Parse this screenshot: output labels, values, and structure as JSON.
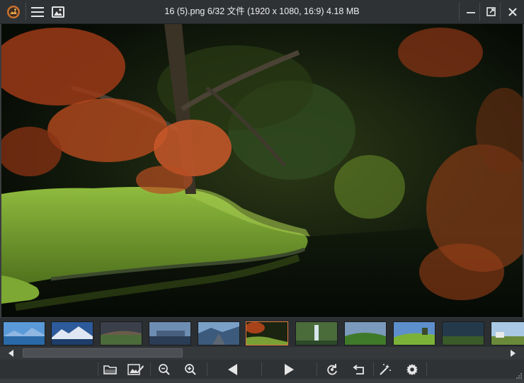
{
  "window": {
    "title": "16 (5).png 6/32 文件 (1920 x 1080, 16:9) 4.18 MB",
    "app_icon": "app-logo-icon",
    "menu_icon": "hamburger-menu-icon",
    "gallery_icon": "image-gallery-icon",
    "controls": [
      "minimize-icon",
      "restore-icon",
      "close-icon"
    ]
  },
  "viewer": {
    "image": "autumn-pond-landscape"
  },
  "thumbnails": {
    "count_visible": 11,
    "active_index": 5,
    "items": [
      "mountain-lake",
      "snowy-mountains",
      "sunset-hills",
      "city-skyline",
      "mountain-road",
      "autumn-pond",
      "waterfall",
      "green-meadow",
      "grassy-hills",
      "dark-field",
      "cattle-field"
    ]
  },
  "scrollbar": {
    "left_icon": "scroll-left-icon",
    "right_icon": "scroll-right-icon"
  },
  "toolbar": {
    "tools": [
      "open-folder-icon",
      "image-edit-icon",
      "zoom-out-icon",
      "zoom-in-icon",
      "previous-icon",
      "next-icon",
      "rotate-icon",
      "undo-icon",
      "magic-wand-icon",
      "settings-icon"
    ]
  },
  "colors": {
    "accent": "#e0743a",
    "titlebar": "#2f3235",
    "background": "#3a3d40"
  }
}
